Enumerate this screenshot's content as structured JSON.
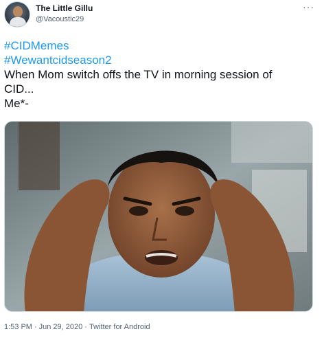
{
  "tweet": {
    "author_name": "The Little Gillu",
    "author_handle": "@Vacoustic29",
    "more_glyph": "···",
    "hashtags": [
      "#CIDMemes",
      "#Wewantcidseason2"
    ],
    "text_lines": [
      "When Mom switch offs the TV in morning session of",
      "CID...",
      "Me*-"
    ],
    "time": "1:53 PM",
    "date": "Jun 29, 2020",
    "source": "Twitter for Android",
    "separator": "·"
  },
  "colors": {
    "link": "#1d9bf0",
    "text": "#0f1419",
    "secondary": "#536471"
  },
  "icons": [
    "more-icon",
    "avatar"
  ]
}
